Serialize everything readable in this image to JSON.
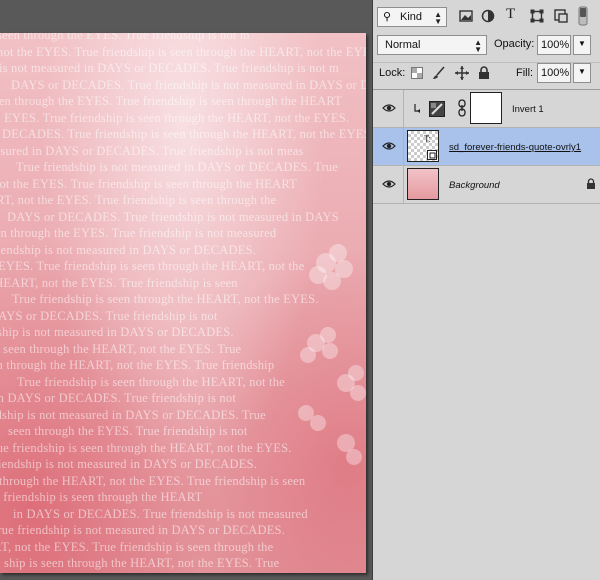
{
  "canvas": {
    "quote_lines": [
      "ship is seen through the EYES.  True friendship is not m",
      "not the EYES.  True friendship is seen through the HEART, not the EYES.",
      "ship is not measured in DAYS or DECADES.  True friendship is not m",
      "DAYS or DECADES.  True friendship is not measured in DAYS or DECADES.",
      "seen through the EYES.  True friendship is seen through the HEART",
      "not the EYES.  True friendship is seen through the HEART, not the EYES.",
      "DECADES.  True friendship is seen through the HEART, not the EYES.",
      "measured in DAYS or DECADES.  True friendship is not meas",
      "True friendship is not measured in DAYS or DECADES.  True",
      "not the EYES.  True friendship is seen through the HEART",
      "HEART, not the EYES.  True friendship is seen through the",
      "DAYS or DECADES.  True friendship is not measured in DAYS",
      "seen through the EYES.  True friendship is not measured",
      "True friendship is not measured in DAYS or DECADES.",
      "EYES.  True friendship is seen through the HEART, not the",
      "the HEART, not the EYES.  True friendship is seen",
      "True friendship is seen through the HEART, not the EYES.",
      "DAYS or DECADES.  True friendship is not",
      "friendship is not measured in DAYS or DECADES.",
      "seen through the HEART, not the EYES.  True",
      "seen through the HEART, not the EYES.  True friendship",
      "True friendship is seen through the HEART, not the",
      "in DAYS or DECADES.  True friendship is not",
      "friendship is not measured in DAYS or DECADES.  True",
      "seen through the EYES.  True friendship is not",
      "True friendship is seen through the HEART, not the EYES.",
      "True friendship is not measured in DAYS or DECADES.",
      "through the HEART, not the EYES.  True friendship is seen",
      "True friendship is seen through the HEART",
      "in DAYS or DECADES.  True friendship is not measured",
      "True friendship is not measured in DAYS or DECADES.",
      "HEART, not the EYES.  True friendship is seen through the",
      "ship is seen through the HEART, not the EYES.  True",
      "the EYES.  True friendship is seen through the HEART, not"
    ]
  },
  "layers_panel": {
    "filter": {
      "kind_label": "Kind"
    },
    "blend_mode": "Normal",
    "opacity": {
      "label": "Opacity:",
      "value": "100%"
    },
    "lock": {
      "label": "Lock:"
    },
    "fill": {
      "label": "Fill:",
      "value": "100%"
    },
    "layers": [
      {
        "name": "Invert 1",
        "type": "adjustment",
        "clipped": true
      },
      {
        "name": "sd_forever-friends-quote-ovrly1",
        "type": "smart-object",
        "selected": true
      },
      {
        "name": "Background",
        "type": "background",
        "locked": true
      }
    ]
  }
}
